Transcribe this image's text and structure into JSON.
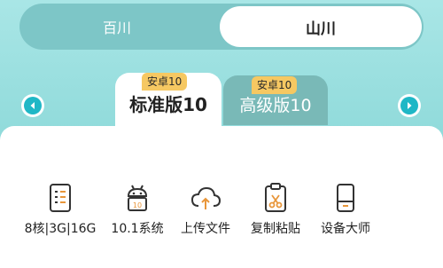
{
  "segmented": {
    "left_label": "百川",
    "right_label": "山川"
  },
  "tabs": [
    {
      "label": "标准版10",
      "badge": "安卓10"
    },
    {
      "label": "高级版10",
      "badge": "安卓10"
    }
  ],
  "features": [
    {
      "label": "8核|3G|16G",
      "icon": "spec-list-icon"
    },
    {
      "label": "10.1系统",
      "icon": "android-robot-icon"
    },
    {
      "label": "上传文件",
      "icon": "cloud-upload-icon"
    },
    {
      "label": "复制粘贴",
      "icon": "clipboard-scissors-icon"
    },
    {
      "label": "设备大师",
      "icon": "phone-device-icon"
    }
  ],
  "colors": {
    "accent": "#1fb7c6",
    "badge": "#f6c862",
    "icon_orange": "#e8963a"
  }
}
